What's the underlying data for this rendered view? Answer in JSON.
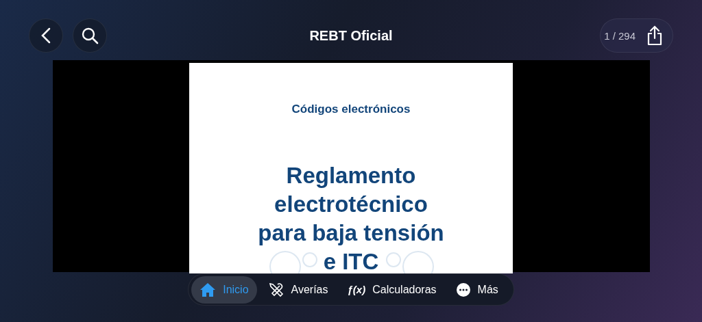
{
  "header": {
    "title": "REBT Oficial",
    "page_counter": "1 / 294"
  },
  "document": {
    "subtitle": "Códigos electrónicos",
    "title_lines": [
      "Reglamento",
      "electrotécnico",
      "para baja tensión",
      "e ITC"
    ]
  },
  "tab_bar": [
    {
      "kind": "home",
      "label": "Inicio",
      "selected": true
    },
    {
      "kind": "tools",
      "label": "Averías",
      "selected": false
    },
    {
      "kind": "function",
      "icon_text": "ƒ(x)",
      "label": "Calculadoras",
      "selected": false
    },
    {
      "kind": "more",
      "label": "Más",
      "selected": false
    }
  ]
}
